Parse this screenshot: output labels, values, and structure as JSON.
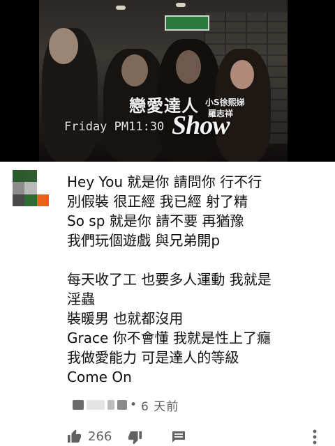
{
  "video": {
    "song_title": "戀愛達人",
    "artist_line1": "小S徐熙娣",
    "artist_line2": "羅志祥",
    "show_logo": "Show",
    "timestamp": "Friday PM11:30"
  },
  "comment": {
    "lines": [
      "Hey You 就是你 請問你 行不行",
      "別假裝 很正經 我已經 射了精",
      "So sp 就是你 請不要 再猶豫",
      "我們玩個遊戲 與兄弟開p",
      "",
      "每天收了工 也要多人運動 我就是",
      "淫蟲",
      "裝暖男 也就都沒用",
      "Grace 你不會懂 我就是性上了癮",
      "我做愛能力 可是達人的等級",
      "Come On"
    ],
    "separator": "•",
    "time_ago": "6 天前",
    "like_count": "266"
  },
  "avatar_colors": [
    "#2b5a2b",
    "#2f5d2f",
    "#ffffff",
    "#8c8c8c",
    "#b9b9b9",
    "#ffffff",
    "#4a4a4a",
    "#2f6b35",
    "#e8601a"
  ],
  "icons": [
    "thumb-up-icon",
    "thumb-down-icon",
    "reply-icon",
    "more-vert-icon"
  ]
}
